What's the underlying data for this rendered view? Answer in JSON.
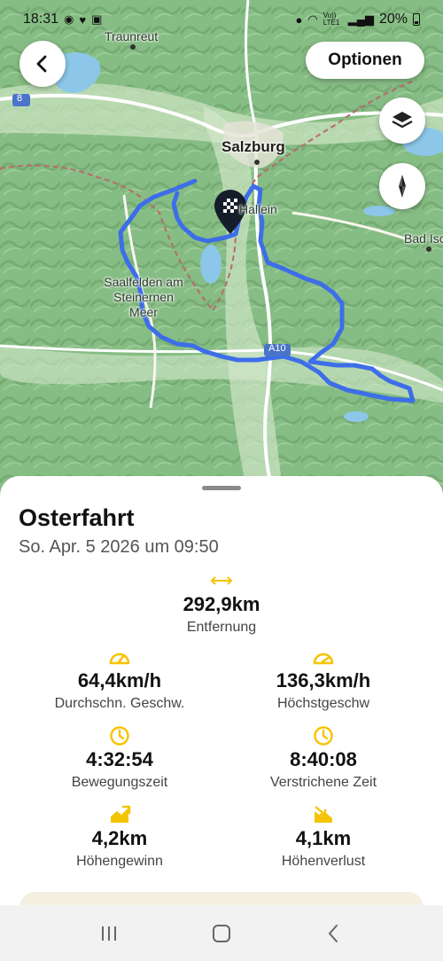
{
  "status_bar": {
    "time": "18:31",
    "battery": "20%",
    "network": "Vo)) LTE1"
  },
  "map": {
    "labels": {
      "traunreut": "Traunreut",
      "salzburg": "Salzburg",
      "hallein": "Hallein",
      "saalfelden": "Saalfelden am Steinernen Meer",
      "bad_ischl": "Bad Isc",
      "road_8": "8",
      "road_a10": "A10"
    },
    "route_color": "#3d6ee8",
    "marker_icon": "checkered-flag-icon"
  },
  "controls": {
    "back_icon": "chevron-left-icon",
    "options_label": "Optionen",
    "layers_icon": "layers-icon",
    "compass_icon": "compass-icon"
  },
  "ride": {
    "title": "Osterfahrt",
    "date": "So. Apr. 5 2026 um 09:50",
    "accent_color": "#f5c400",
    "distance": {
      "value": "292,9km",
      "label": "Entfernung",
      "icon": "distance-icon"
    },
    "avg_speed": {
      "value": "64,4km/h",
      "label": "Durchschn. Geschw.",
      "icon": "speedometer-icon"
    },
    "max_speed": {
      "value": "136,3km/h",
      "label": "Höchstgeschw",
      "icon": "speedometer-icon"
    },
    "moving_time": {
      "value": "4:32:54",
      "label": "Bewegungszeit",
      "icon": "clock-icon"
    },
    "elapsed_time": {
      "value": "8:40:08",
      "label": "Verstrichene Zeit",
      "icon": "clock-icon"
    },
    "elev_gain": {
      "value": "4,2km",
      "label": "Höhengewinn",
      "icon": "elevation-up-icon"
    },
    "elev_loss": {
      "value": "4,1km",
      "label": "Höhenverlust",
      "icon": "elevation-down-icon"
    }
  },
  "navbar": {
    "recents_icon": "recents-icon",
    "home_icon": "home-icon",
    "back_icon": "back-icon"
  }
}
